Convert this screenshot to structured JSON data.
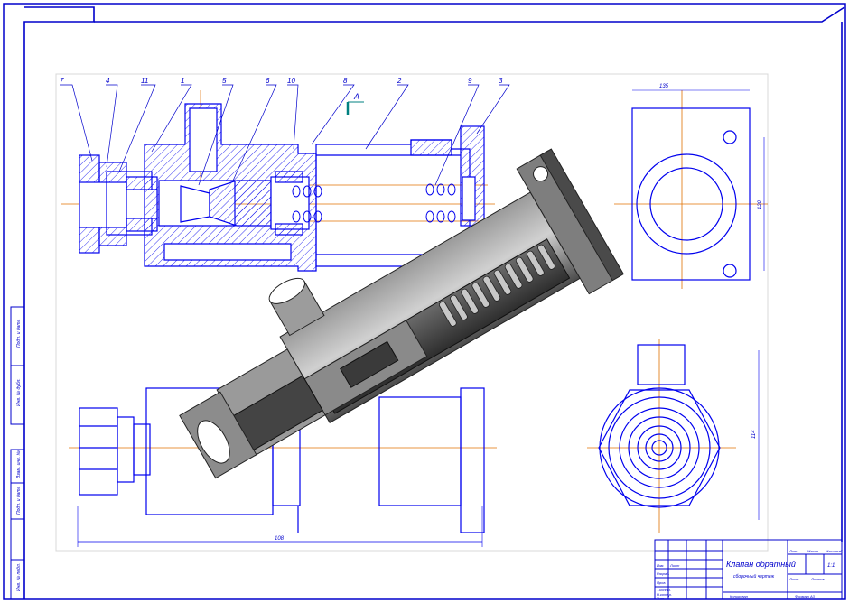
{
  "drawing": {
    "title_main": "Клапан обратный",
    "title_sub": "сборочный чертеж",
    "doc_code": "",
    "sheet_label": "1:1",
    "view_marker": "А",
    "dim_length": "108",
    "dim_flange": "135",
    "dim_height": "120",
    "dim_side": "114"
  },
  "callouts": [
    {
      "num": "7"
    },
    {
      "num": "4"
    },
    {
      "num": "11"
    },
    {
      "num": "1"
    },
    {
      "num": "5"
    },
    {
      "num": "6"
    },
    {
      "num": "10"
    },
    {
      "num": "8"
    },
    {
      "num": "2"
    },
    {
      "num": "9"
    },
    {
      "num": "3"
    }
  ],
  "side_stamps": [
    "Подп. и дата",
    "Инв. № дубл.",
    "Взам. инв. №",
    "Подп. и дата",
    "Инв. № подл."
  ],
  "title_block": {
    "row_labels": [
      "Изм.",
      "Лист",
      "Разраб.",
      "Пров.",
      "Т.контр.",
      "Н.контр.",
      "Утв."
    ],
    "col_labels": [
      "Лит.",
      "Масса",
      "Масштаб"
    ],
    "sheet_text": "Лист",
    "sheets_text": "Листов",
    "copied": "Копировал",
    "format": "Формат  A3"
  },
  "colors": {
    "frame": "#0000cc",
    "line": "#0000ee",
    "axis": "#e07000",
    "marker": "#008080",
    "shade_dark": "#3c3c3c",
    "shade_mid": "#7a7a7a",
    "shade_light": "#b8b8b8"
  }
}
